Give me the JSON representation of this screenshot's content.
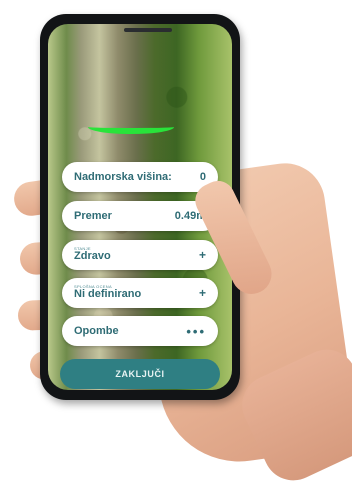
{
  "fields": {
    "altitude_label": "Nadmorska višina:",
    "altitude_value": "0",
    "diameter_label": "Premer",
    "diameter_value": "0.49m",
    "status_caption": "STANJE",
    "status_value": "Zdravo",
    "status_action": "+",
    "category_caption": "SPLOŠNA OCENA",
    "category_value": "Ni definirano",
    "category_action": "+",
    "notes_label": "Opombe",
    "notes_action": "•••"
  },
  "finish_label": "ZAKLJUČI",
  "colors": {
    "accent": "#2f7f83",
    "measure_arc": "#29e33a",
    "text": "#2f6c75"
  }
}
